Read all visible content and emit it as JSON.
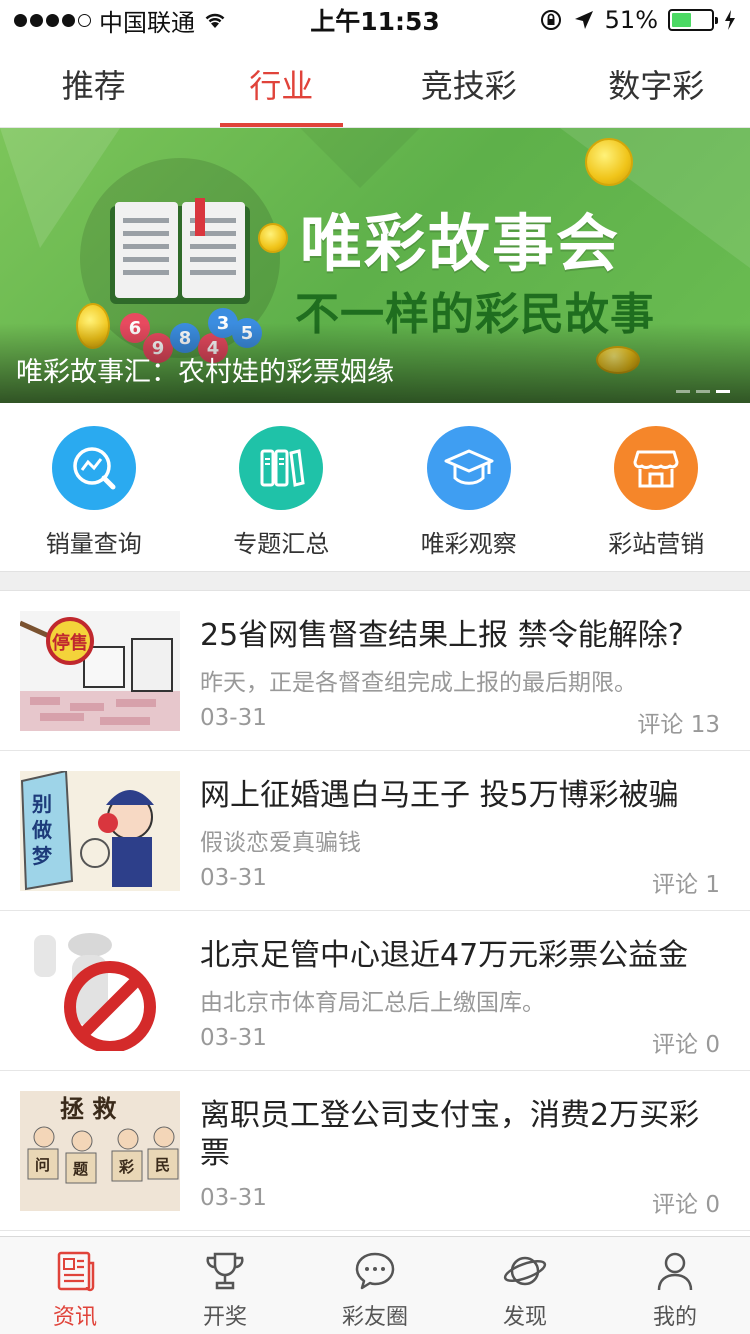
{
  "status_bar": {
    "carrier": "中国联通",
    "time": "上午11:53",
    "battery_pct": "51%",
    "battery_level": 0.51
  },
  "top_tabs": [
    {
      "label": "推荐",
      "active": false
    },
    {
      "label": "行业",
      "active": true
    },
    {
      "label": "竞技彩",
      "active": false
    },
    {
      "label": "数字彩",
      "active": false
    }
  ],
  "banner": {
    "title": "唯彩故事会",
    "subtitle": "不一样的彩民故事",
    "caption": "唯彩故事汇：农村娃的彩票姻缘",
    "balls": [
      "6",
      "9",
      "8",
      "4",
      "3",
      "5"
    ]
  },
  "shortcuts": [
    {
      "label": "销量查询",
      "icon": "chart-search-icon",
      "color": "#2aaaf0"
    },
    {
      "label": "专题汇总",
      "icon": "books-icon",
      "color": "#1fc2a8"
    },
    {
      "label": "唯彩观察",
      "icon": "graduation-cap-icon",
      "color": "#3f9ef2"
    },
    {
      "label": "彩站营销",
      "icon": "store-icon",
      "color": "#f5862a"
    }
  ],
  "news": [
    {
      "title": "25省网售督查结果上报 禁令能解除?",
      "desc": "昨天，正是各督查组完成上报的最后期限。",
      "date": "03-31",
      "comments": "评论 13",
      "thumb_text": "停售"
    },
    {
      "title": "网上征婚遇白马王子 投5万博彩被骗",
      "desc": "假谈恋爱真骗钱",
      "date": "03-31",
      "comments": "评论 1",
      "thumb_text": "别做梦了"
    },
    {
      "title": "北京足管中心退近47万元彩票公益金",
      "desc": "由北京市体育局汇总后上缴国库。",
      "date": "03-31",
      "comments": "评论 0",
      "thumb_text": ""
    },
    {
      "title": "离职员工登公司支付宝，消费2万买彩票",
      "desc": "",
      "date": "03-31",
      "comments": "评论 0",
      "thumb_text": "拯救问题彩民"
    }
  ],
  "bottom_nav": [
    {
      "label": "资讯",
      "icon": "news-icon",
      "active": true
    },
    {
      "label": "开奖",
      "icon": "trophy-icon",
      "active": false
    },
    {
      "label": "彩友圈",
      "icon": "chat-bubble-icon",
      "active": false
    },
    {
      "label": "发现",
      "icon": "planet-icon",
      "active": false
    },
    {
      "label": "我的",
      "icon": "user-icon",
      "active": false
    }
  ]
}
